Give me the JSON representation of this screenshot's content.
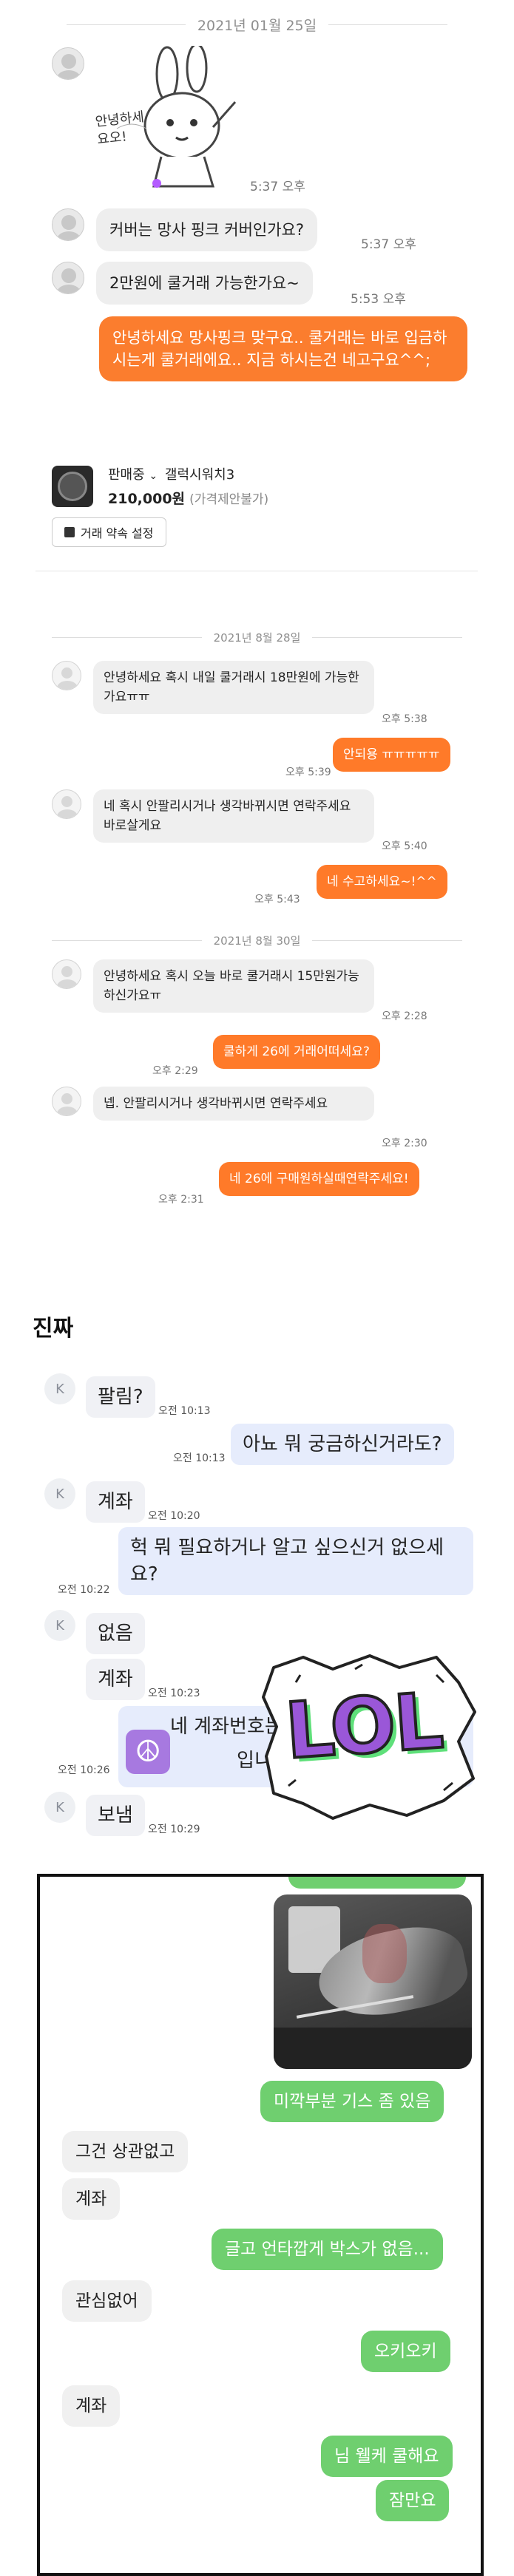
{
  "panel1": {
    "date": "2021년 01월 25일",
    "sticker_text": "안녕하세요오!",
    "messages": [
      {
        "text": "커버는 망사 핑크 커버인가요?",
        "time": "5:37 오후"
      },
      {
        "text": "2만원에 쿨거래 가능한가요~",
        "time": "5:53 오후"
      },
      {
        "text": "안녕하세요 망사핑크 맞구요.. 쿨거래는 바로 입금하시는게 쿨거래에요.. 지금 하시는건 네고구요^^;"
      }
    ],
    "sticker_time": "5:37 오후",
    "product": {
      "status": "판매중",
      "name": "갤럭시워치3",
      "price": "210,000원",
      "price_note": "(가격제안불가)",
      "appointment_button": "거래 약속 설정"
    }
  },
  "panel2": {
    "date1": "2021년 8월 28일",
    "date2": "2021년 8월 30일",
    "messages": [
      {
        "text": "안녕하세요 혹시 내일 쿨거래시 18만원에 가능한가요ㅠㅠ",
        "time": "오후 5:38"
      },
      {
        "text": "안되용 ㅠㅠㅠㅠㅠ",
        "time": "오후 5:39"
      },
      {
        "text": "네 혹시 안팔리시거나 생각바뀌시면 연락주세요 바로살게요",
        "time": "오후 5:40"
      },
      {
        "text": "네 수고하세요~!^^",
        "time": "오후 5:43"
      },
      {
        "text": "안녕하세요 혹시 오늘 바로 쿨거래시 15만원가능하신가요ㅠ",
        "time": "오후 2:28"
      },
      {
        "text": "쿨하게 26에 거래어떠세요?",
        "time": "오후 2:29"
      },
      {
        "text": "넵. 안팔리시거나 생각바뀌시면 연락주세요",
        "time": "오후 2:30"
      },
      {
        "text": "네 26에 구매원하실때연락주세요!",
        "time": "오후 2:31"
      }
    ]
  },
  "panel3": {
    "heading": "진짜",
    "avatar_letter": "K",
    "messages": [
      {
        "text": "팔림?",
        "time": "오전 10:13"
      },
      {
        "text": "아뇨 뭐 궁금하신거라도?",
        "time": "오전 10:13"
      },
      {
        "text": "계좌",
        "time": "오전 10:20"
      },
      {
        "text": "헉 뭐 필요하거나 알고 싶으신거 없으세요?",
        "time": "오전 10:22"
      },
      {
        "text": "없음"
      },
      {
        "text": "계좌",
        "time": "오전 10:23"
      },
      {
        "text": "네 계좌번호는",
        "text2": "입니다",
        "time": "오전 10:26"
      },
      {
        "text": "보냄",
        "time": "오전 10:29"
      }
    ],
    "lol_sticker": "LOL"
  },
  "panel4": {
    "messages": [
      {
        "text": "미깍부분 기스 좀 있음"
      },
      {
        "text": "그건 상관없고"
      },
      {
        "text": "계좌"
      },
      {
        "text": "글고 언타깝게 박스가 없음..."
      },
      {
        "text": "관심없어"
      },
      {
        "text": "오키오키"
      },
      {
        "text": "계좌"
      },
      {
        "text": "님 웰케 쿨해요"
      },
      {
        "text": "잠만요"
      }
    ]
  },
  "colors": {
    "orange": "#fb7d2e",
    "kakao_blue": "#e6ecfc",
    "line_green": "#6fcf6f",
    "lol_purple": "#9a57d8",
    "lol_green": "#5fe07a"
  }
}
